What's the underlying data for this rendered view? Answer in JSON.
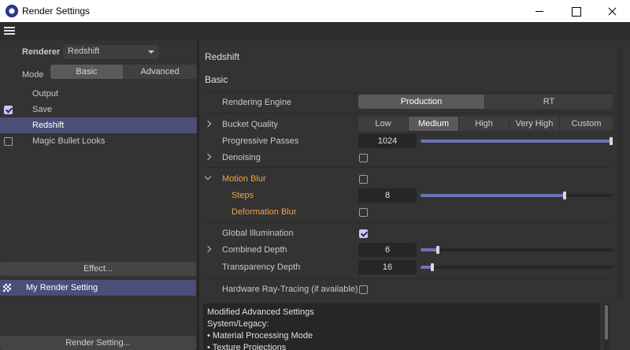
{
  "window": {
    "title": "Render Settings"
  },
  "left": {
    "renderer_label": "Renderer",
    "renderer_value": "Redshift",
    "mode_label": "Mode",
    "mode_tabs": [
      {
        "label": "Basic",
        "active": true
      },
      {
        "label": "Advanced",
        "active": false
      }
    ],
    "items": [
      {
        "label": "Output",
        "checkbox": "none",
        "selected": false
      },
      {
        "label": "Save",
        "checkbox": "checked",
        "selected": false
      },
      {
        "label": "Redshift",
        "checkbox": "none",
        "selected": true
      },
      {
        "label": "Magic Bullet Looks",
        "checkbox": "unchecked",
        "selected": false
      }
    ],
    "effect_button": "Effect...",
    "render_setting_item": "My Render Setting",
    "render_setting_button": "Render Setting..."
  },
  "right": {
    "title": "Redshift",
    "section": "Basic",
    "rendering_engine": {
      "label": "Rendering Engine",
      "options": [
        "Production",
        "RT"
      ],
      "selected": "Production"
    },
    "bucket_quality": {
      "label": "Bucket Quality",
      "options": [
        "Low",
        "Medium",
        "High",
        "Very High",
        "Custom"
      ],
      "selected": "Medium"
    },
    "progressive_passes": {
      "label": "Progressive Passes",
      "value": "1024",
      "slider_fraction": 1.0
    },
    "denoising": {
      "label": "Denoising",
      "checked": false
    },
    "motion_blur": {
      "label": "Motion Blur",
      "checked": false
    },
    "steps": {
      "label": "Steps",
      "value": "8",
      "slider_fraction": 0.75
    },
    "deformation_blur": {
      "label": "Deformation Blur",
      "checked": false
    },
    "global_illumination": {
      "label": "Global Illumination",
      "checked": true
    },
    "combined_depth": {
      "label": "Combined Depth",
      "value": "6",
      "slider_fraction": 0.09
    },
    "transparency_depth": {
      "label": "Transparency Depth",
      "value": "16",
      "slider_fraction": 0.06
    },
    "hardware_rt": {
      "label": "Hardware Ray-Tracing (if available)",
      "checked": false
    },
    "notes": [
      "Modified Advanced Settings",
      "System/Legacy:",
      "• Material Processing Mode",
      "• Texture Projections"
    ]
  },
  "colors": {
    "accent": "#4a4e78",
    "orange": "#f0a04a",
    "slider_fill": "#6c73b4"
  }
}
